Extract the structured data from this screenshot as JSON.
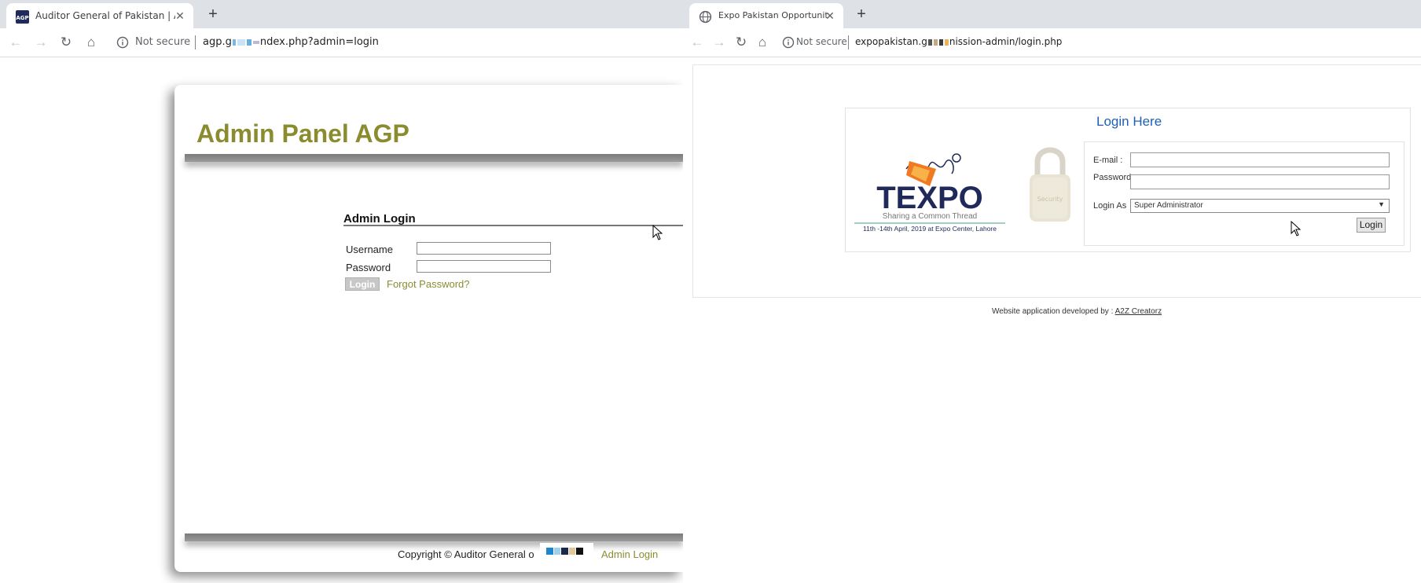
{
  "left_window": {
    "tab": {
      "title": "Auditor General of Pakistan | AGP",
      "favicon": "agp-favicon-icon"
    },
    "toolbar": {
      "security_label": "Not secure",
      "url_prefix": "agp.g",
      "url_suffix": "ndex.php?admin=login"
    },
    "page": {
      "heading": "Admin Panel AGP",
      "login_heading": "Admin Login",
      "username_label": "Username",
      "password_label": "Password",
      "login_button": "Login",
      "forgot_link": "Forgot Password?",
      "footer_copyright": "Copyright © Auditor General o",
      "footer_admin_link": "Admin Login"
    }
  },
  "right_window": {
    "tab": {
      "title": "Expo Pakistan Opportunities Unli",
      "favicon": "globe-icon"
    },
    "toolbar": {
      "security_label": "Not secure",
      "url_prefix": "expopakistan.g",
      "url_suffix": "nission-admin/login.php"
    },
    "page": {
      "login_heading": "Login Here",
      "logo": {
        "brand": "TEXPO",
        "tagline": "Sharing a Common Thread",
        "dates": "11th -14th April, 2019 at Expo Center, Lahore"
      },
      "padlock_text": "Security",
      "email_label": "E-mail :",
      "password_label": "Password",
      "login_as_label": "Login As",
      "login_as_value": "Super Administrator",
      "login_button": "Login",
      "credit_text": "Website application developed by :",
      "credit_link": "A2Z Creatorz"
    }
  },
  "colors": {
    "agp_olive": "#8b8c2f",
    "expo_blue": "#1f5fb5",
    "tabstrip": "#dee1e6"
  }
}
